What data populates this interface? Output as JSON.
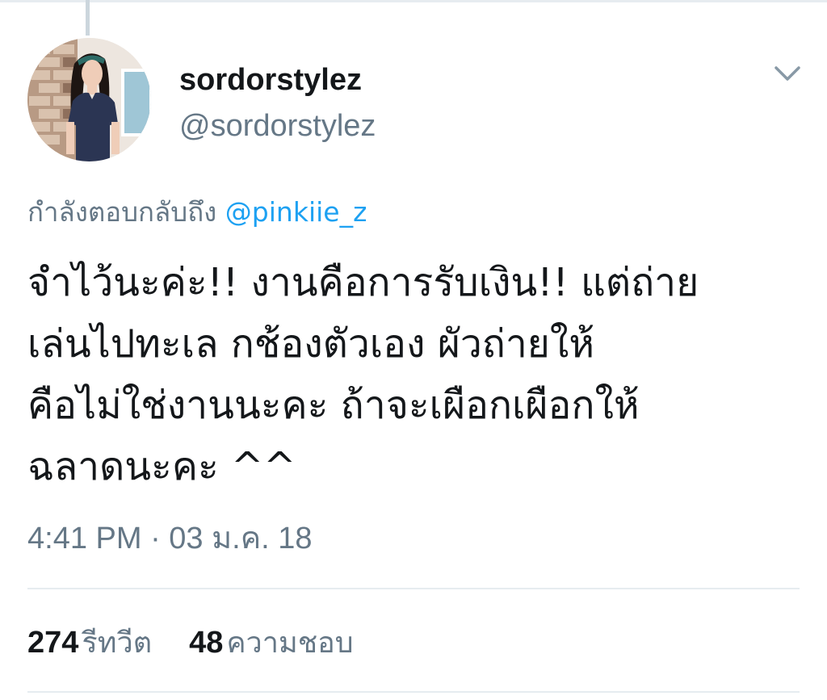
{
  "tweet": {
    "author": {
      "display_name": "sordorstylez",
      "username": "@sordorstylez"
    },
    "reply_prefix": "กำลังตอบกลับถึง",
    "reply_to": "@pinkiie_z",
    "text_lines": [
      "จำไว้นะค่ะ!! งานคือการรับเงิน!! แต่ถ่าย",
      "เล่นไปทะเล กช้องตัวเอง ผัวถ่ายให้",
      "คือไม่ใช่งานนะคะ ถ้าจะเผือกเผือกให้",
      "ฉลาดนะคะ ^^"
    ],
    "timestamp": "4:41 PM · 03 ม.ค. 18",
    "stats": {
      "retweets_count": "274",
      "retweets_label": "รีทวีต",
      "likes_count": "48",
      "likes_label": "ความชอบ"
    }
  },
  "icons": {
    "menu": "chevron-down-icon"
  },
  "colors": {
    "text_primary": "#14171a",
    "text_secondary": "#657786",
    "link": "#1da1f2",
    "divider": "#e6ecf0",
    "thread_line": "#ccd6dd"
  }
}
